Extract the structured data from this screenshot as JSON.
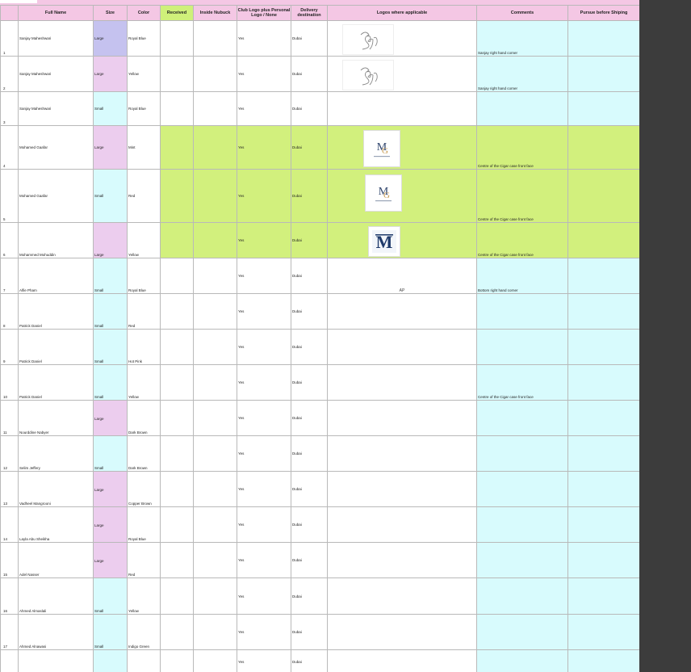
{
  "headers": {
    "full_name": "Full Name",
    "size": "Size",
    "color": "Color",
    "received": "Received",
    "inside_nubuck": "Inside Nubuck",
    "club_logo": "Club Logo plus Personal Logo / None",
    "delivery": "Delivery destination",
    "logos": "Logos where applicable",
    "comments": "Comments",
    "pursue": "Pursue before Shiping"
  },
  "rows": [
    {
      "num": "1",
      "name": "Sanjay Maheshwari",
      "size": "Large",
      "color": "Royal Blue",
      "club": "Yes",
      "delivery": "Dubai",
      "comment": "Sanjay right hand corner",
      "logo_text": "Sanjay"
    },
    {
      "num": "2",
      "name": "Sanjay Maheshwari",
      "size": "Large",
      "color": "Yellow",
      "club": "Yes",
      "delivery": "Dubai",
      "comment": "Sanjay right hand corner",
      "logo_text": "Sanjay"
    },
    {
      "num": "3",
      "name": "Sanjay Maheshwari",
      "size": "Small",
      "color": "Royal Blue",
      "club": "Yes",
      "delivery": "Dubai",
      "comment": "",
      "logo_text": ""
    },
    {
      "num": "4",
      "name": "Mohamed Gaafar",
      "size": "Large",
      "color": "Mint",
      "club": "Yes",
      "delivery": "Dubai",
      "comment": "Centre of the Cigar case front face",
      "logo_text": "MG"
    },
    {
      "num": "5",
      "name": "Mohamed Gaafar",
      "size": "Small",
      "color": "Red",
      "club": "Yes",
      "delivery": "Dubai",
      "comment": "Centre of the Cigar case front face",
      "logo_text": "MG"
    },
    {
      "num": "6",
      "name": "Mohammed Mohuddin",
      "size": "Large",
      "color": "Yellow",
      "club": "Yes",
      "delivery": "Dubai",
      "comment": "Centre of the Cigar case front face",
      "logo_text": "M"
    },
    {
      "num": "7",
      "name": "Alfie Pham",
      "size": "Small",
      "color": "Royal Blue",
      "club": "Yes",
      "delivery": "Dubai",
      "comment": "Bottom right hand corner",
      "logo_text": "AP"
    },
    {
      "num": "8",
      "name": "Patrick Daniel",
      "size": "Small",
      "color": "Red",
      "club": "Yes",
      "delivery": "Dubai",
      "comment": "",
      "logo_text": ""
    },
    {
      "num": "9",
      "name": "Patrick Daniel",
      "size": "Small",
      "color": "Hot Pink",
      "club": "Yes",
      "delivery": "Dubai",
      "comment": "",
      "logo_text": ""
    },
    {
      "num": "10",
      "name": "Patrick Daniel",
      "size": "Small",
      "color": "Yellow",
      "club": "Yes",
      "delivery": "Dubai",
      "comment": "Centre of the Cigar case front face",
      "logo_text": ""
    },
    {
      "num": "11",
      "name": "Nourddine Nabyer",
      "size": "Large",
      "color": "Dark Brown",
      "club": "Yes",
      "delivery": "Dubai",
      "comment": "",
      "logo_text": ""
    },
    {
      "num": "12",
      "name": "Selim Jeffery",
      "size": "Small",
      "color": "Dark Brown",
      "club": "Yes",
      "delivery": "Dubai",
      "comment": "",
      "logo_text": ""
    },
    {
      "num": "13",
      "name": "Vadheel Mangrooni",
      "size": "Large",
      "color": "Copper Brown",
      "club": "Yes",
      "delivery": "Dubai",
      "comment": "",
      "logo_text": ""
    },
    {
      "num": "14",
      "name": "Layla Abu Sheikha",
      "size": "Large",
      "color": "Royal Blue",
      "club": "Yes",
      "delivery": "Dubai",
      "comment": "",
      "logo_text": ""
    },
    {
      "num": "15",
      "name": "Adel Nasser",
      "size": "Large",
      "color": "Red",
      "club": "Yes",
      "delivery": "Dubai",
      "comment": "",
      "logo_text": ""
    },
    {
      "num": "16",
      "name": "Ahmed Almaslali",
      "size": "Small",
      "color": "Yellow",
      "club": "Yes",
      "delivery": "Dubai",
      "comment": "",
      "logo_text": ""
    },
    {
      "num": "17",
      "name": "Ahmed Alnawasi",
      "size": "Small",
      "color": "Indigo Green",
      "club": "Yes",
      "delivery": "Dubai",
      "comment": "",
      "logo_text": ""
    },
    {
      "num": "",
      "name": "",
      "size": "",
      "color": "",
      "club": "Yes",
      "delivery": "Dubai",
      "comment": "",
      "logo_text": ""
    }
  ]
}
